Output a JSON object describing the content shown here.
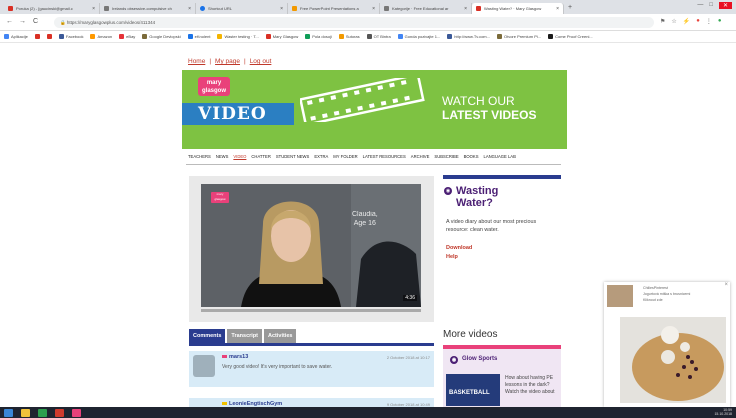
{
  "browser": {
    "tabs": [
      {
        "label": "Poruka (2) - [gaucinski@gmail.c",
        "color": "#d93025"
      },
      {
        "label": "Irelands obsessive-compulsive ch",
        "color": "#777777"
      },
      {
        "label": "Shortcut URL",
        "color": "#1a73e8"
      },
      {
        "label": "Free PowerPoint Presentations a",
        "color": "#f29900"
      },
      {
        "label": "Kategorije · Free Educational ar",
        "color": "#777777"
      },
      {
        "label": "Wasting Water? · Mary Glasgow",
        "color": "#d93025"
      }
    ],
    "new_tab": "+",
    "win_min": "—",
    "win_max": "□",
    "win_close": "✕",
    "back": "←",
    "forward": "→",
    "reload": "C",
    "url": "https://maryglasgowplus.com/videos/411344",
    "bookmarks": [
      {
        "label": "Aplikacije",
        "color": "#4285f4"
      },
      {
        "label": "",
        "color": "#d93025"
      },
      {
        "label": "",
        "color": "#d93025"
      },
      {
        "label": "Facebook",
        "color": "#3b5998"
      },
      {
        "label": "Amazon",
        "color": "#ff9900"
      },
      {
        "label": "eBay",
        "color": "#e53238"
      },
      {
        "label": "Google Devlopski",
        "color": "#7b6b3a"
      },
      {
        "label": "eKnolent",
        "color": "#1a73e8"
      },
      {
        "label": "Waster testing · T...",
        "color": "#f4b400"
      },
      {
        "label": "Mary Glasgow",
        "color": "#d93025"
      },
      {
        "label": "Pola dosoji",
        "color": "#0f9d58"
      },
      {
        "label": "Sutoras",
        "color": "#f29900"
      },
      {
        "label": "OT Bintra",
        "color": "#555555"
      },
      {
        "label": "Gonda pozivajte 1...",
        "color": "#4285f4"
      },
      {
        "label": "http://www.Tv.com...",
        "color": "#3b5998"
      },
      {
        "label": "Otvore Premium Pi...",
        "color": "#7b6b3a"
      },
      {
        "label": "Come Proof Creeni...",
        "color": "#1a1a1a"
      }
    ]
  },
  "page": {
    "top_links": [
      "Home",
      "My page",
      "Log out"
    ],
    "separator": "|",
    "logo": "mary glasgow",
    "video_label": "VIDEO",
    "watch_line1": "WATCH OUR",
    "watch_line2": "LATEST VIDEOS",
    "nav": [
      "TEACHERS",
      "NEWS",
      "VIDEO",
      "CHATTER",
      "STUDENT NEWS",
      "EXTRA",
      "MY FOLDER",
      "LATEST RESOURCES",
      "ARCHIVE",
      "SUBSCRIBE",
      "BOOKS",
      "LANGUAGE LAB"
    ],
    "video_caption_name": "Claudia,",
    "video_caption_age": "Age 16",
    "video_duration": "4:36",
    "badge": "mary glasgow",
    "side_title_line1": "Wasting",
    "side_title_line2": "Water?",
    "side_desc": "A video diary about our most precious resource: clean water.",
    "download": "Download",
    "help": "Help",
    "comment_tabs": [
      "Comments",
      "Transcript",
      "Activities"
    ],
    "comments": [
      {
        "name": "mars13",
        "date": "2 October 2018 at 10:17",
        "text": "Very good video! It's very important to save water."
      },
      {
        "name": "LeonieEngtischGym",
        "date": "9 October 2018 at 10:49",
        "text": ""
      }
    ],
    "more_videos": "More videos",
    "more_item_title": "Glow Sports",
    "more_item_thumb": "BASKETBALL",
    "more_item_desc": "How about having PE lessons in the dark? Watch the video about"
  },
  "ad": {
    "title": "ChiliesPinterest",
    "line2": "Jogurtová miška s brusnicemi",
    "line3": "Kliknout zde",
    "close": "×"
  },
  "taskbar": {
    "time": "10:59",
    "date": "15.10.2018",
    "icons": [
      "#3a86d6",
      "#f0c23b",
      "#2e9e4e",
      "#d03a2d",
      "#e9417a"
    ]
  }
}
